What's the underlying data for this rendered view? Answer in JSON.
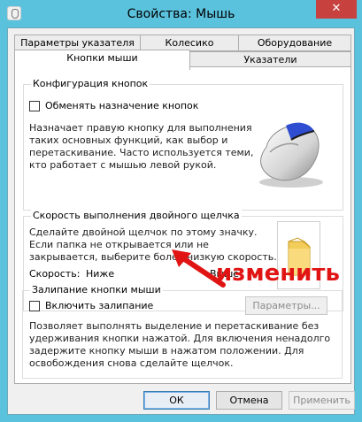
{
  "window": {
    "title": "Свойства: Мышь",
    "close_glyph": "✕"
  },
  "tabs": {
    "row1": [
      {
        "label": "Параметры указателя"
      },
      {
        "label": "Колесико"
      },
      {
        "label": "Оборудование"
      }
    ],
    "row2": [
      {
        "label": "Кнопки мыши",
        "active": true
      },
      {
        "label": "Указатели"
      }
    ]
  },
  "button_config": {
    "title": "Конфигурация кнопок",
    "swap_checkbox_label": "Обменять назначение кнопок",
    "swap_checked": false,
    "description": [
      "Назначает правую кнопку для выполнения",
      "таких основных функций, как выбор и",
      "перетаскивание. Часто используется теми,",
      "кто работает с мышью левой рукой."
    ],
    "image_icon": "mouse-icon"
  },
  "double_click": {
    "title": "Скорость выполнения двойного щелчка",
    "description": [
      "Сделайте двойной щелчок по этому значку.",
      "Если папка не открывается или не",
      "закрывается, выберите более низкую скорость."
    ],
    "speed_label": "Скорость:",
    "slow_label": "Ниже",
    "fast_label": "Выше",
    "speed_level": 0.55,
    "test_icon": "folder-icon"
  },
  "click_lock": {
    "title": "Залипание кнопки мыши",
    "checkbox_label": "Включить залипание",
    "checked": false,
    "settings_button": "Параметры...",
    "settings_enabled": false,
    "description": [
      "Позволяет выполнять выделение и перетаскивание без",
      "удерживания кнопки нажатой. Для включения ненадолго",
      "задержите кнопку мыши в нажатом положении. Для",
      "освобождения снова сделайте щелчок."
    ]
  },
  "footer": {
    "ok": "ОК",
    "cancel": "Отмена",
    "apply": "Применить",
    "apply_enabled": false
  },
  "annotation": {
    "text": "изменить",
    "color": "#e11414"
  },
  "colors": {
    "title_bar": "#5bc2de",
    "close_button": "#c7413e",
    "panel": "#ffffff",
    "dialog": "#f0f0f0"
  }
}
